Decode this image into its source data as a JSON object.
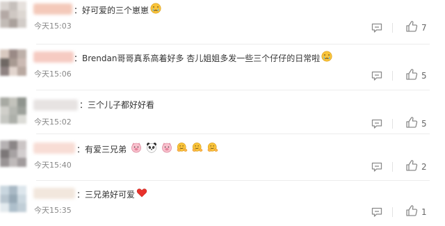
{
  "comments": [
    {
      "text": "：好可爱的三个崽崽",
      "emojis": [
        "crying-face"
      ],
      "time": "今天15:03",
      "likes": "7",
      "avatar_colors": [
        "#d9d3cf",
        "#c6c0bc",
        "#e6e1dd",
        "#b4a9a5",
        "#cfc8c3",
        "#ddd7d2",
        "#c2bbb6",
        "#aaa19c",
        "#d2ccc8"
      ],
      "username_color": "#f4c9ba"
    },
    {
      "text": "：Brendan哥哥真系高着好多 杏儿姐姐多发一些三个仔仔的日常啦",
      "emojis": [
        "crying-face"
      ],
      "time": "今天15:06",
      "likes": "5",
      "avatar_colors": [
        "#d8c9c0",
        "#9a8a86",
        "#bdb0a9",
        "#6f6864",
        "#a89a92",
        "#cbbab3",
        "#8e8281",
        "#e2d5ce",
        "#b9a9a1"
      ],
      "username_color": "#f6cbc2"
    },
    {
      "text": "：三个儿子都好好看",
      "emojis": [],
      "time": "今天15:02",
      "likes": "5",
      "avatar_colors": [
        "#a8aaa3",
        "#c3c3bc",
        "#8f948e",
        "#d0cfca",
        "#b5b7b1",
        "#9da19b",
        "#c6c7c2",
        "#adb0aa",
        "#dcdcd7"
      ],
      "username_color": "#e7e3e2"
    },
    {
      "text": "：有爱三兄弟",
      "emojis": [
        "pig-face",
        "panda-face",
        "pig-face",
        "hug-hands",
        "hug-hands",
        "hug-hands"
      ],
      "time": "今天15:40",
      "likes": "2",
      "avatar_colors": [
        "#b6b2b3",
        "#8b8687",
        "#cbc5c5",
        "#7c7778",
        "#a7a2a3",
        "#d3cecf",
        "#999495",
        "#bfbaba",
        "#a19b9c"
      ],
      "username_color": "#f8ddd5"
    },
    {
      "text": "：三兄弟好可爱",
      "emojis": [
        "red-heart"
      ],
      "time": "今天15:35",
      "likes": "1",
      "avatar_colors": [
        "#c9d6df",
        "#a9b9c5",
        "#dde6ec",
        "#b8c5cf",
        "#97a9b6",
        "#ccd8e0",
        "#e3eaee",
        "#aebfcb",
        "#c1ced7"
      ],
      "username_color": "#f2e7dd"
    }
  ]
}
